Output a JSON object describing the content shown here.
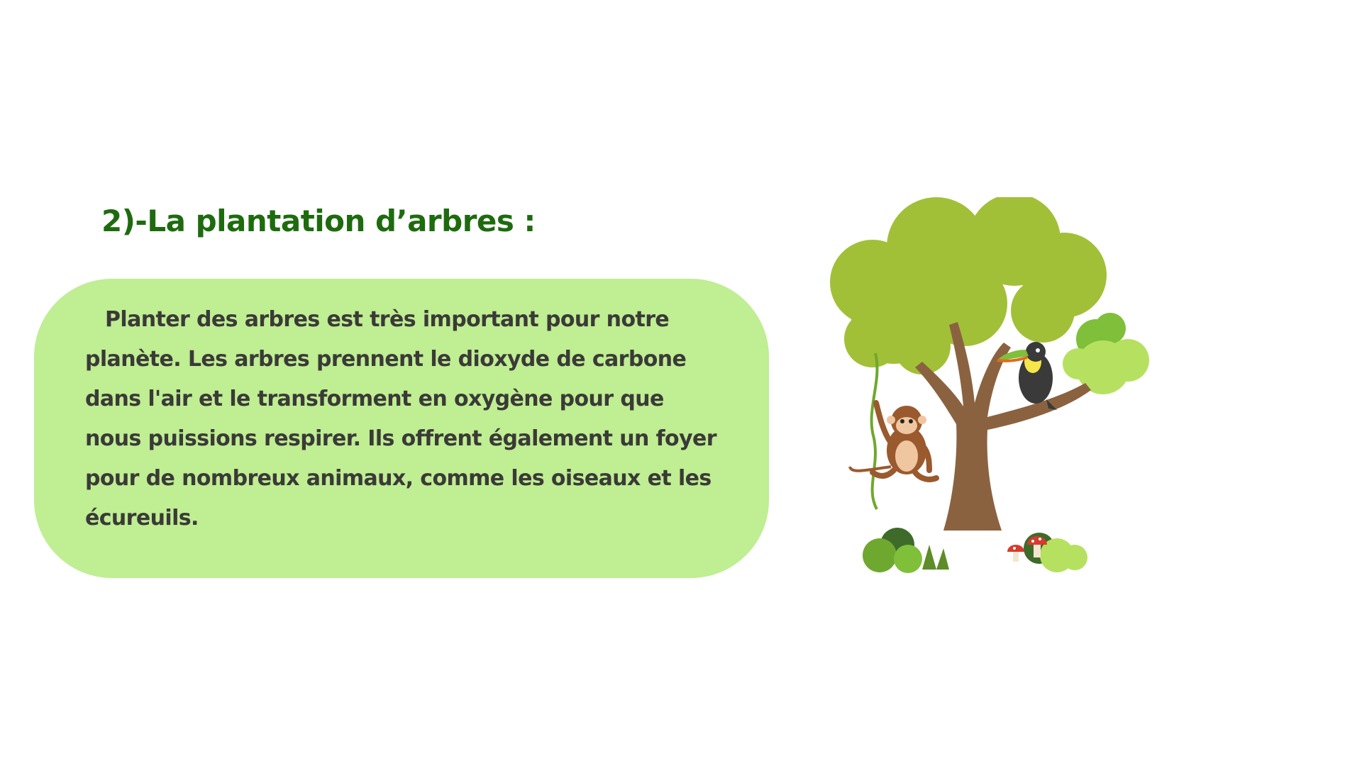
{
  "slide": {
    "heading": "2)-La plantation d’arbres :",
    "body": "Planter des arbres est très important pour notre planète. Les arbres prennent le dioxyde de carbone dans l'air et le transforment en oxygène pour que nous puissions respirer. Ils offrent également un foyer pour de nombreux animaux, comme les oiseaux et les écureuils."
  },
  "illustration": {
    "subject": "tree-with-monkey-and-toucan",
    "colors": {
      "foliage": "#a2c037",
      "foliage_light": "#b6e160",
      "trunk": "#8b6240",
      "card": "#bfee93",
      "heading": "#1e6b0f"
    }
  }
}
